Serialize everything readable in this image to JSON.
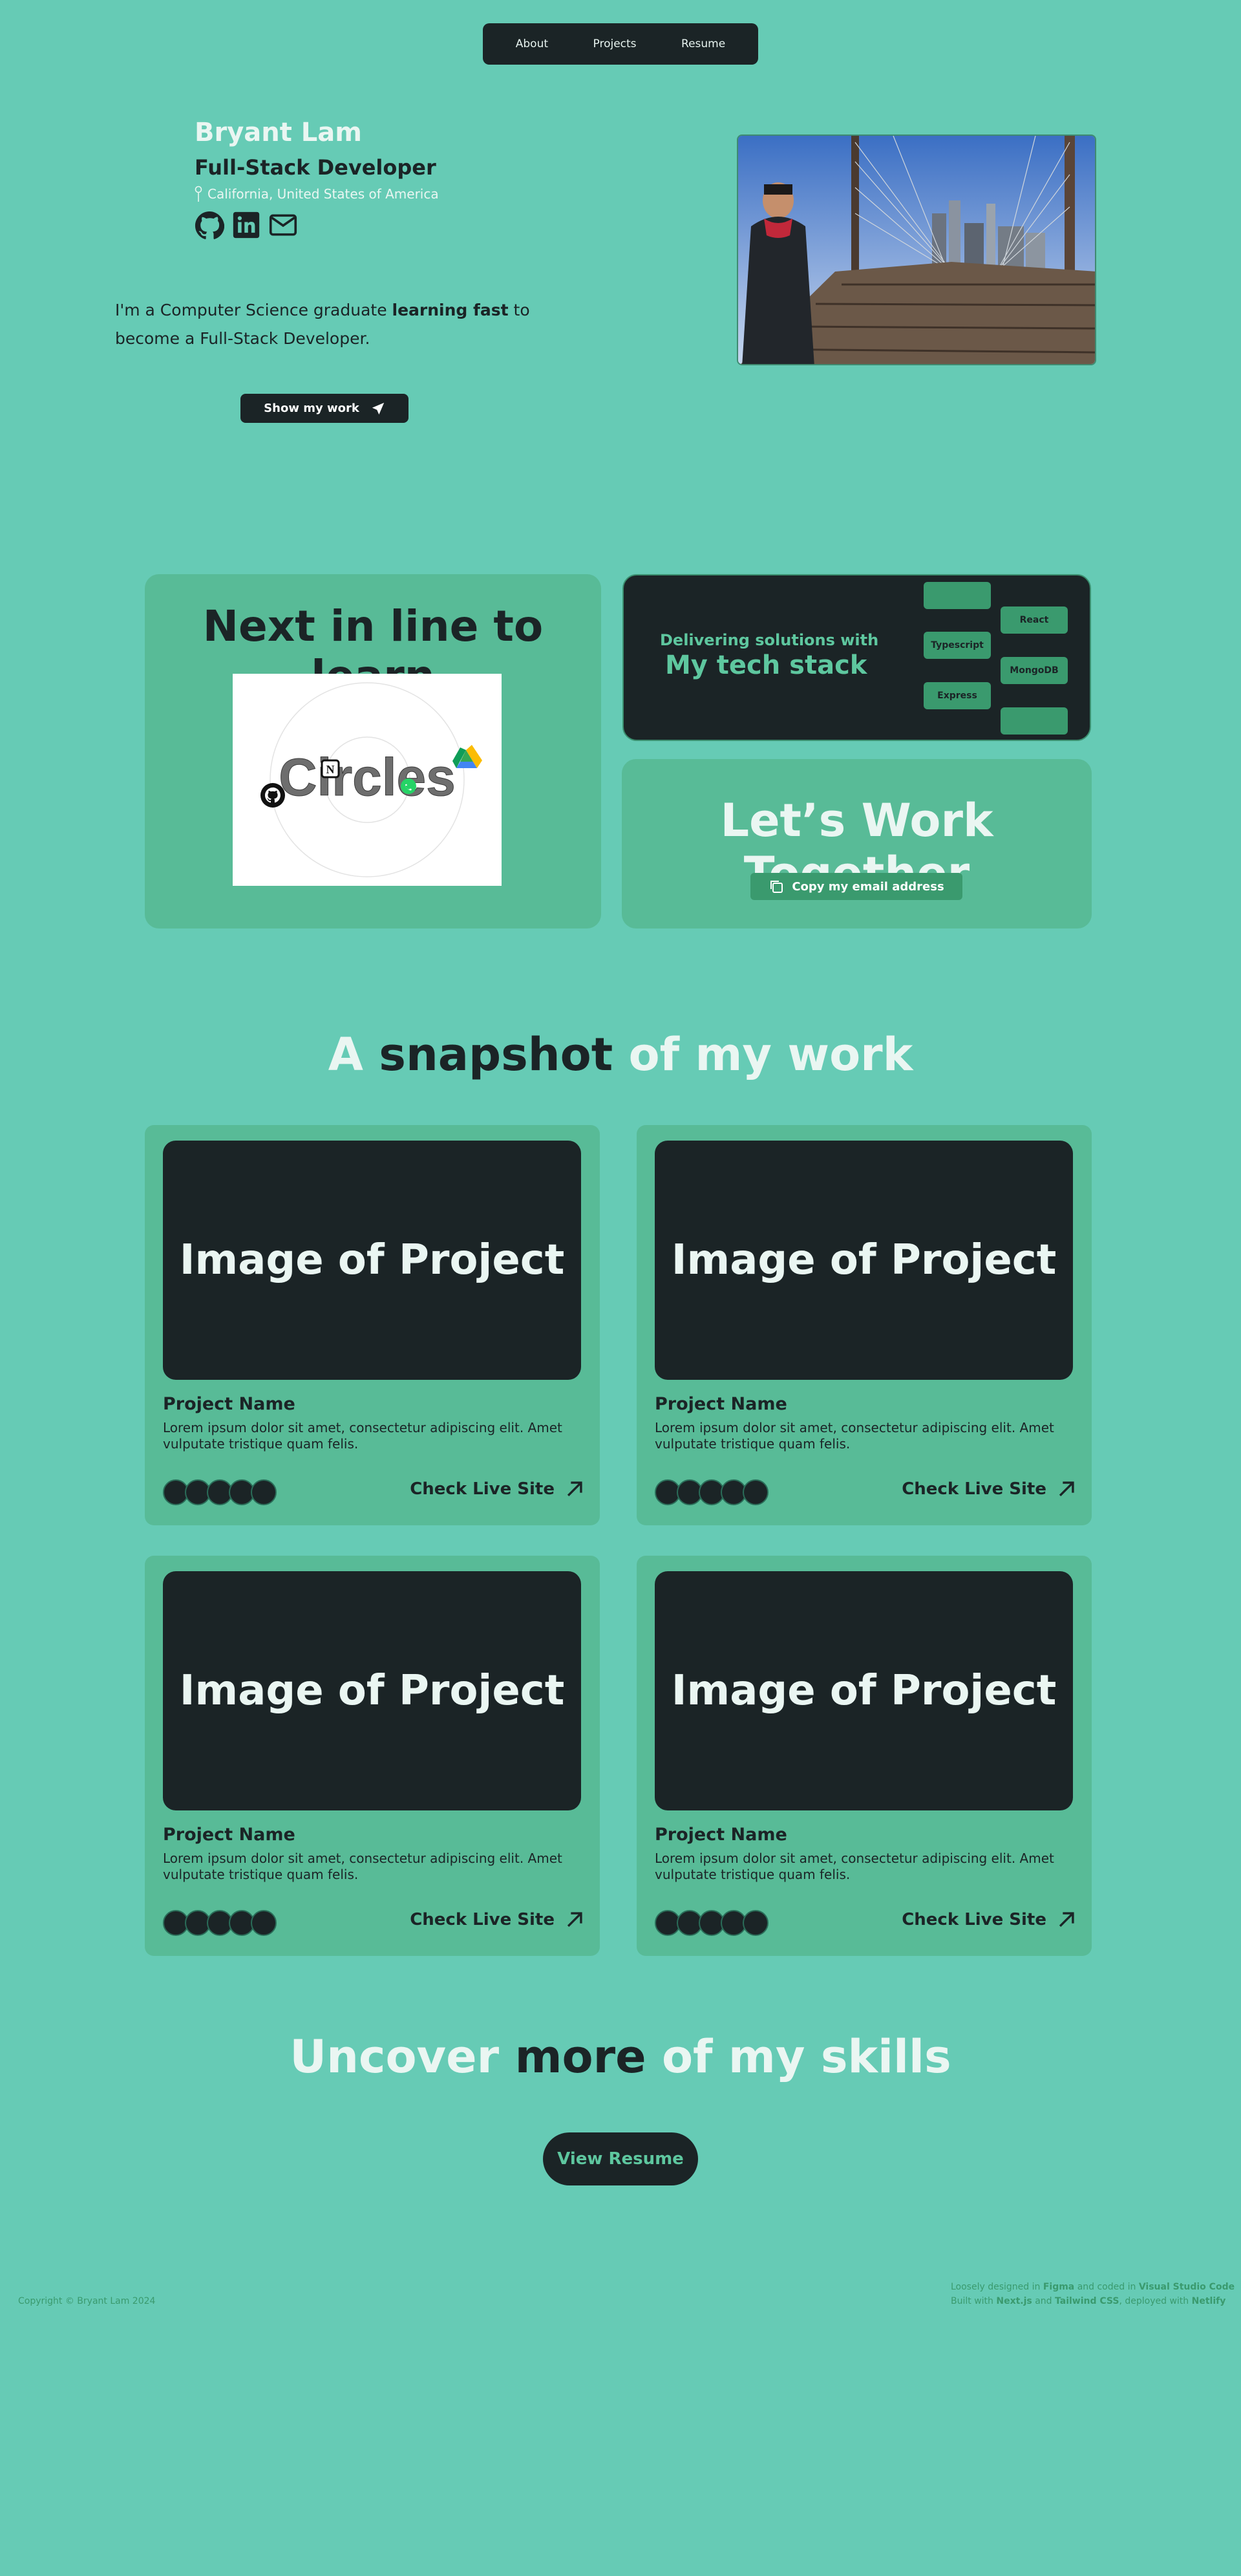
{
  "nav": {
    "items": [
      "About",
      "Projects",
      "Resume"
    ]
  },
  "hero": {
    "name": "Bryant Lam",
    "role": "Full-Stack Developer",
    "location": "California, United States of America",
    "intro_before": "I'm a Computer Science graduate ",
    "intro_bold": "learning fast",
    "intro_after": " to become a Full-Stack Developer.",
    "cta_label": "Show my work",
    "socials": [
      "github-icon",
      "linkedin-icon",
      "mail-icon"
    ]
  },
  "learn": {
    "title": "Next in line to learn",
    "logo_text": "Circles"
  },
  "tech": {
    "subtitle": "Delivering solutions with",
    "title": "My tech stack",
    "pills": [
      "",
      "React",
      "Typescript",
      "MongoDB",
      "Express",
      ""
    ]
  },
  "work": {
    "title": "Let’s Work Together",
    "copy_label": "Copy my email address"
  },
  "snapshot": {
    "pre": "A ",
    "bold": "snapshot",
    "post": " of my work"
  },
  "projects": [
    {
      "image_label": "Image of Project",
      "name": "Project Name",
      "desc": "Lorem ipsum dolor sit amet, consectetur adipiscing elit. Amet vulputate tristique quam felis.",
      "link": "Check Live Site"
    },
    {
      "image_label": "Image of Project",
      "name": "Project Name",
      "desc": "Lorem ipsum dolor sit amet, consectetur adipiscing elit. Amet vulputate tristique quam felis.",
      "link": "Check Live Site"
    },
    {
      "image_label": "Image of Project",
      "name": "Project Name",
      "desc": "Lorem ipsum dolor sit amet, consectetur adipiscing elit. Amet vulputate tristique quam felis.",
      "link": "Check Live Site"
    },
    {
      "image_label": "Image of Project",
      "name": "Project Name",
      "desc": "Lorem ipsum dolor sit amet, consectetur adipiscing elit. Amet vulputate tristique quam felis.",
      "link": "Check Live Site"
    }
  ],
  "skills": {
    "pre": "Uncover ",
    "bold": "more",
    "post": " of my skills",
    "button": "View Resume"
  },
  "footer": {
    "copyright": "Copyright © Bryant Lam 2024",
    "line1_a": "Loosely designed in ",
    "line1_b": "Figma",
    "line1_c": " and coded in ",
    "line1_d": "Visual Studio Code",
    "line2_a": "Built with ",
    "line2_b": "Next.js",
    "line2_c": " and ",
    "line2_d": "Tailwind CSS",
    "line2_e": ", deployed with ",
    "line2_f": "Netlify"
  },
  "colors": {
    "background": "#66cbb5",
    "dark": "#1b2426",
    "card": "#58bb97",
    "accent": "#3a9a6e",
    "light_text": "#eaf6f2"
  }
}
